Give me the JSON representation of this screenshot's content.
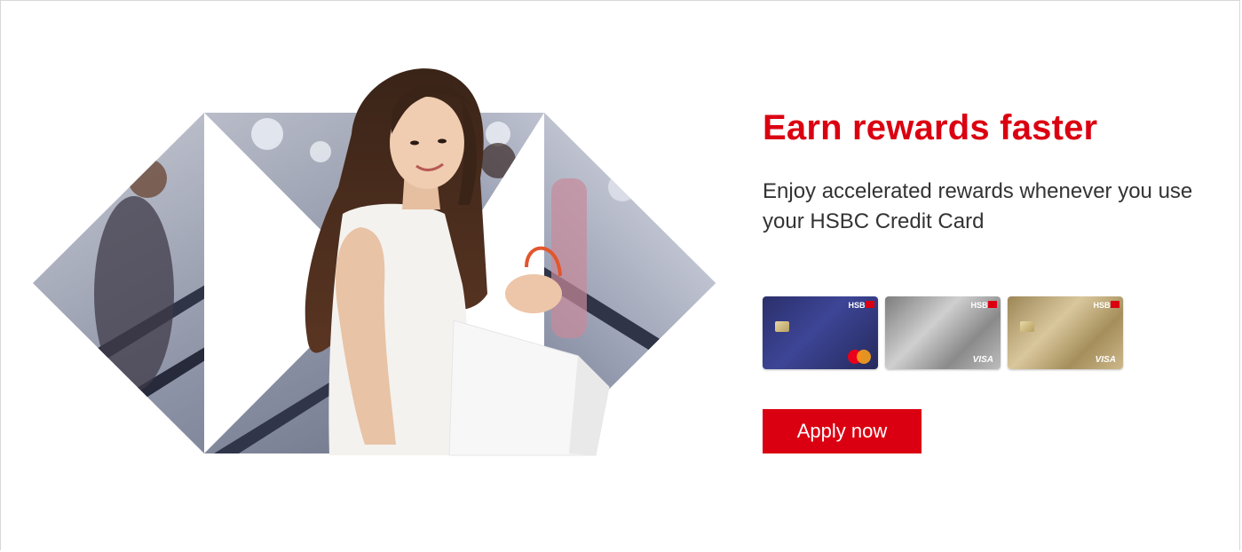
{
  "promo": {
    "headline": "Earn rewards faster",
    "subtext": "Enjoy accelerated rewards whenever you use your HSBC Credit Card",
    "cta_label": "Apply now"
  },
  "cards": [
    {
      "brand": "HSBC",
      "scheme": "mastercard",
      "style": "premier"
    },
    {
      "brand": "HSBC",
      "scheme": "VISA",
      "style": "platinum"
    },
    {
      "brand": "HSBC",
      "scheme": "VISA",
      "style": "gold"
    }
  ],
  "colors": {
    "brand_red": "#db0011",
    "text": "#333333",
    "background": "#ffffff"
  }
}
